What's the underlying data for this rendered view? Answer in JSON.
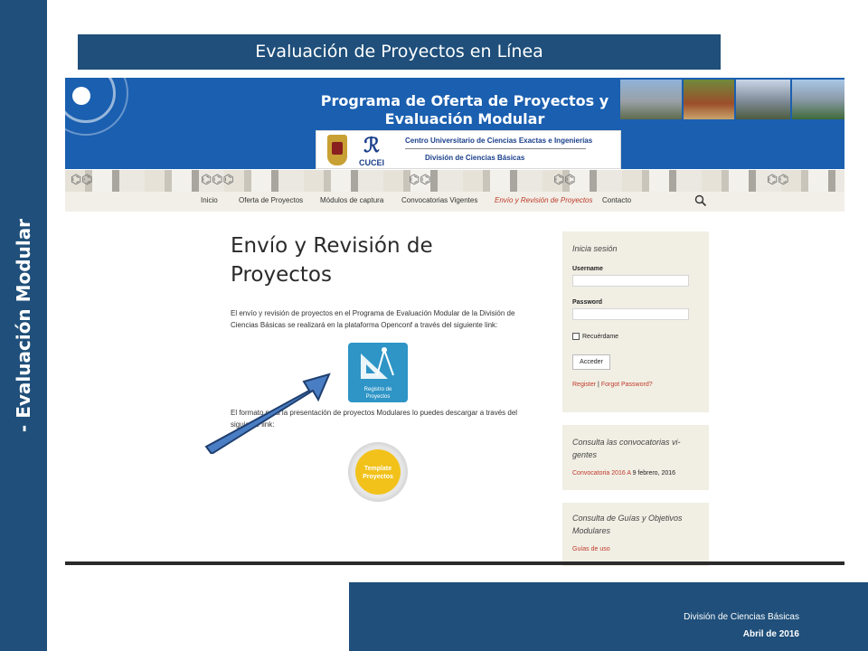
{
  "slide": {
    "side_title": "- Evaluación Modular",
    "title": "Evaluación de Proyectos en Línea",
    "footer_division": "División  de  Ciencias  Básicas",
    "footer_date": "Abril de 2016",
    "accent_color": "#1f4f7a"
  },
  "site": {
    "banner": {
      "title_line1": "Programa de Oferta de Proyectos y",
      "title_line2": "Evaluación Modular",
      "center_name": "Centro Universitario de Ciencias Exactas e Ingenierías",
      "division": "División de Ciencias Básicas",
      "logo_text": "CUCEI",
      "brand_color": "#1a5fb0"
    },
    "nav": {
      "items": [
        {
          "label": "Inicio"
        },
        {
          "label": "Oferta de Proyectos"
        },
        {
          "label": "Módulos de captura"
        },
        {
          "label": "Convocatorias Vigentes"
        },
        {
          "label": "Envío y Revisión de Proyectos",
          "active": true
        },
        {
          "label": "Contacto"
        }
      ],
      "search_icon": "search-icon"
    },
    "main": {
      "title": "Envío y Revisión de Proyectos",
      "paragraph1": "El envío y revisión de proyectos en el Programa de Evaluación Modular de la División de Ciencias Básicas se realizará en la plataforma Openconf a través del siguiente link:",
      "registro_label_line1": "Registro de",
      "registro_label_line2": "Proyectos",
      "paragraph2": "El formato para la presentación de proyectos Modulares lo puedes descargar a través del siguiente link:",
      "template_label_line1": "Template",
      "template_label_line2": "Proyectos"
    },
    "login_widget": {
      "title": "Inicia sesión",
      "username_label": "Username",
      "username_value": "",
      "password_label": "Password",
      "password_value": "",
      "remember_label": "Recuérdame",
      "remember_checked": false,
      "submit_label": "Acceder",
      "register_link": "Register",
      "separator": "|",
      "forgot_link": "Forgot Password?"
    },
    "convocatorias_widget": {
      "title_line1": "Consulta las convocatorias vi-",
      "title_line2": "gentes",
      "link": "Convocatoria 2016 A",
      "date": "9 febrero, 2016"
    },
    "guias_widget": {
      "title_line1": "Consulta de Guías y Objetivos",
      "title_line2": "Modulares",
      "link": "Guías de uso"
    }
  }
}
